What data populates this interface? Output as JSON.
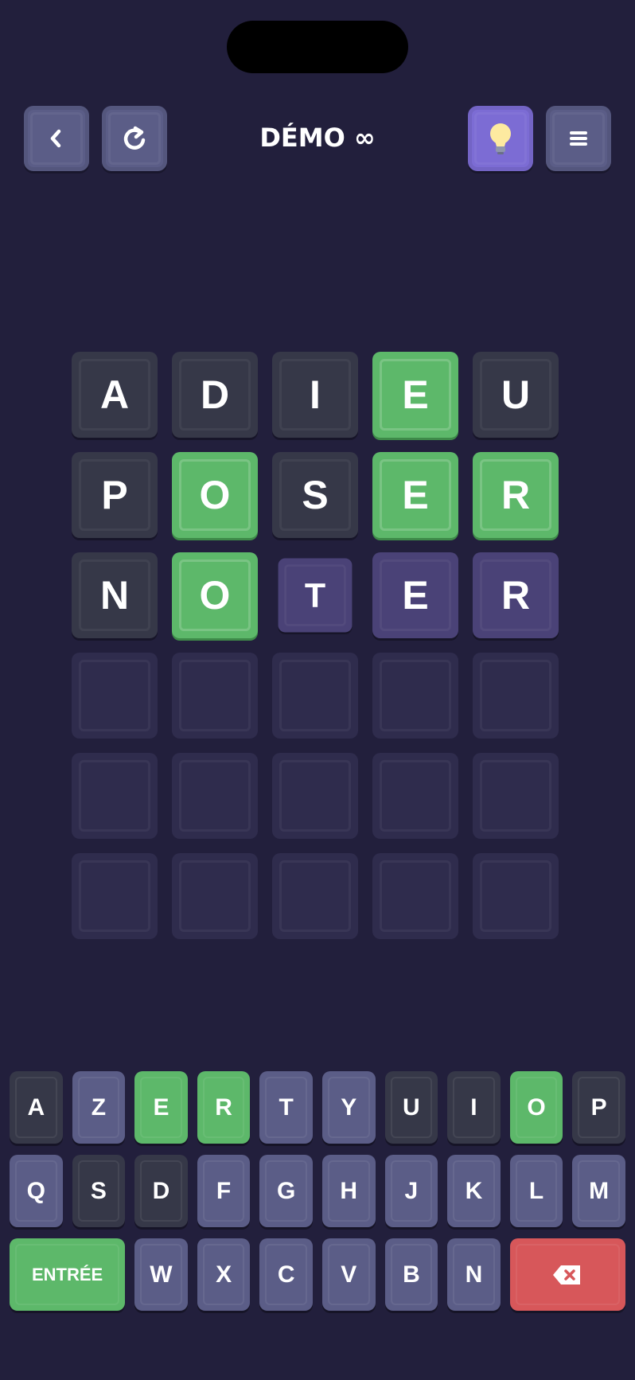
{
  "header": {
    "title": "DÉMO ∞",
    "back_icon": "‹",
    "restart_icon": "↻",
    "hint_icon": "💡",
    "menu_icon": "≡"
  },
  "colors": {
    "background": "#221f3c",
    "correct": "#5db86a",
    "absent": "#363848",
    "typed": "#4a4277",
    "empty": "#2f2c4d",
    "key_unused": "#5b5d87",
    "delete": "#d7575a",
    "hint": "#7c6cd4"
  },
  "board": {
    "rows": [
      [
        {
          "letter": "A",
          "state": "absent"
        },
        {
          "letter": "D",
          "state": "absent"
        },
        {
          "letter": "I",
          "state": "absent"
        },
        {
          "letter": "E",
          "state": "correct"
        },
        {
          "letter": "U",
          "state": "absent"
        }
      ],
      [
        {
          "letter": "P",
          "state": "absent"
        },
        {
          "letter": "O",
          "state": "correct"
        },
        {
          "letter": "S",
          "state": "absent"
        },
        {
          "letter": "E",
          "state": "correct"
        },
        {
          "letter": "R",
          "state": "correct"
        }
      ],
      [
        {
          "letter": "N",
          "state": "absent"
        },
        {
          "letter": "O",
          "state": "correct"
        },
        {
          "letter": "T",
          "state": "typed-small"
        },
        {
          "letter": "E",
          "state": "typed"
        },
        {
          "letter": "R",
          "state": "typed"
        }
      ],
      [
        {
          "letter": "",
          "state": "empty"
        },
        {
          "letter": "",
          "state": "empty"
        },
        {
          "letter": "",
          "state": "empty"
        },
        {
          "letter": "",
          "state": "empty"
        },
        {
          "letter": "",
          "state": "empty"
        }
      ],
      [
        {
          "letter": "",
          "state": "empty"
        },
        {
          "letter": "",
          "state": "empty"
        },
        {
          "letter": "",
          "state": "empty"
        },
        {
          "letter": "",
          "state": "empty"
        },
        {
          "letter": "",
          "state": "empty"
        }
      ],
      [
        {
          "letter": "",
          "state": "empty"
        },
        {
          "letter": "",
          "state": "empty"
        },
        {
          "letter": "",
          "state": "empty"
        },
        {
          "letter": "",
          "state": "empty"
        },
        {
          "letter": "",
          "state": "empty"
        }
      ]
    ]
  },
  "keyboard": {
    "rows": [
      [
        {
          "label": "A",
          "state": "absent"
        },
        {
          "label": "Z",
          "state": "unused"
        },
        {
          "label": "E",
          "state": "correct"
        },
        {
          "label": "R",
          "state": "correct"
        },
        {
          "label": "T",
          "state": "unused"
        },
        {
          "label": "Y",
          "state": "unused"
        },
        {
          "label": "U",
          "state": "absent"
        },
        {
          "label": "I",
          "state": "absent"
        },
        {
          "label": "O",
          "state": "correct"
        },
        {
          "label": "P",
          "state": "absent"
        }
      ],
      [
        {
          "label": "Q",
          "state": "unused"
        },
        {
          "label": "S",
          "state": "absent"
        },
        {
          "label": "D",
          "state": "absent"
        },
        {
          "label": "F",
          "state": "unused"
        },
        {
          "label": "G",
          "state": "unused"
        },
        {
          "label": "H",
          "state": "unused"
        },
        {
          "label": "J",
          "state": "unused"
        },
        {
          "label": "K",
          "state": "unused"
        },
        {
          "label": "L",
          "state": "unused"
        },
        {
          "label": "M",
          "state": "unused"
        }
      ],
      [
        {
          "label": "ENTRÉE",
          "state": "enter"
        },
        {
          "label": "W",
          "state": "unused"
        },
        {
          "label": "X",
          "state": "unused"
        },
        {
          "label": "C",
          "state": "unused"
        },
        {
          "label": "V",
          "state": "unused"
        },
        {
          "label": "B",
          "state": "unused"
        },
        {
          "label": "N",
          "state": "unused"
        },
        {
          "label": "",
          "state": "del",
          "icon": "backspace-icon"
        }
      ]
    ]
  }
}
